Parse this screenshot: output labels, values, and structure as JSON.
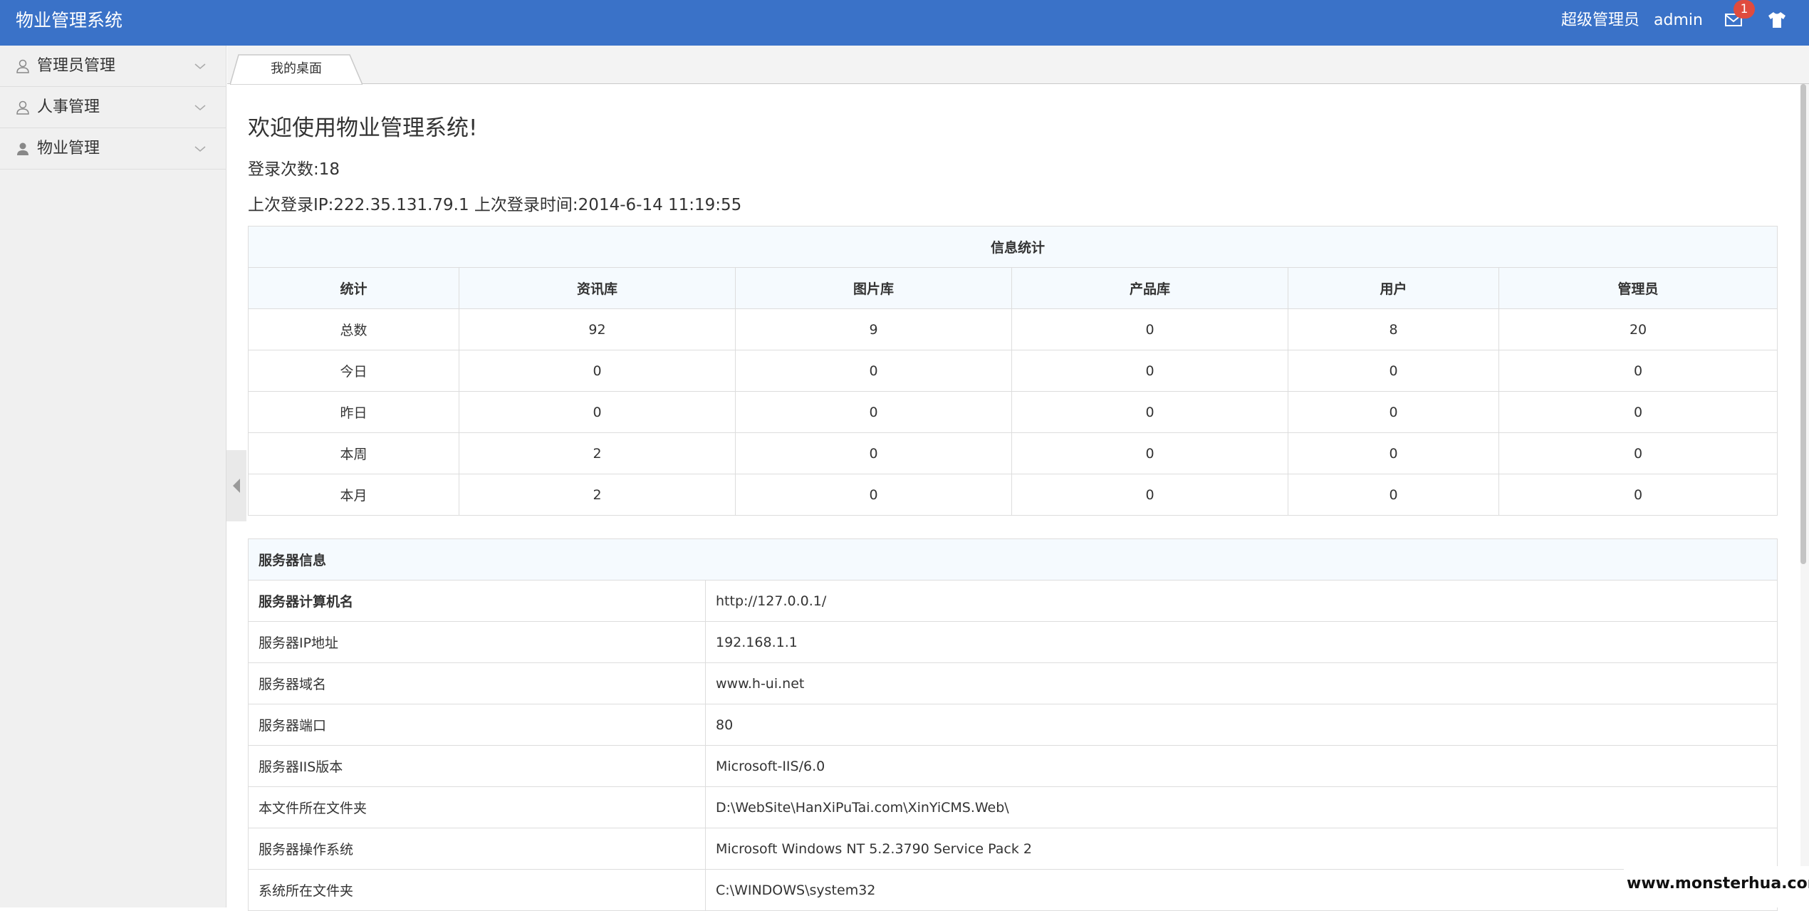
{
  "header": {
    "app_title": "物业管理系统",
    "user_role": "超级管理员",
    "user_name": "admin",
    "message_count": "1",
    "icons": [
      "mail-icon",
      "shirt-icon"
    ]
  },
  "sidebar": {
    "items": [
      {
        "label": "管理员管理",
        "icon": "user-outline-icon"
      },
      {
        "label": "人事管理",
        "icon": "user-outline-icon"
      },
      {
        "label": "物业管理",
        "icon": "user-filled-icon"
      }
    ]
  },
  "tabs": [
    {
      "label": "我的桌面"
    }
  ],
  "main": {
    "welcome": "欢迎使用物业管理系统!",
    "login_count": "登录次数:18",
    "last_login": "上次登录IP:222.35.131.79.1 上次登录时间:2014-6-14 11:19:55"
  },
  "stats_table": {
    "caption": "信息统计",
    "headers": [
      "统计",
      "资讯库",
      "图片库",
      "产品库",
      "用户",
      "管理员"
    ],
    "rows": [
      [
        "总数",
        "92",
        "9",
        "0",
        "8",
        "20"
      ],
      [
        "今日",
        "0",
        "0",
        "0",
        "0",
        "0"
      ],
      [
        "昨日",
        "0",
        "0",
        "0",
        "0",
        "0"
      ],
      [
        "本周",
        "2",
        "0",
        "0",
        "0",
        "0"
      ],
      [
        "本月",
        "2",
        "0",
        "0",
        "0",
        "0"
      ]
    ]
  },
  "server_table": {
    "caption": "服务器信息",
    "rows": [
      [
        "服务器计算机名",
        "http://127.0.0.1/"
      ],
      [
        "服务器IP地址",
        "192.168.1.1"
      ],
      [
        "服务器域名",
        "www.h-ui.net"
      ],
      [
        "服务器端口",
        "80"
      ],
      [
        "服务器IIS版本",
        "Microsoft-IIS/6.0"
      ],
      [
        "本文件所在文件夹",
        "D:\\WebSite\\HanXiPuTai.com\\XinYiCMS.Web\\"
      ],
      [
        "服务器操作系统",
        "Microsoft Windows NT 5.2.3790 Service Pack 2"
      ],
      [
        "系统所在文件夹",
        "C:\\WINDOWS\\system32"
      ]
    ]
  },
  "watermark": "www.monsterhua.com",
  "colors": {
    "header_bg": "#3a72c8",
    "badge_bg": "#e04b3e",
    "sidebar_bg": "#f0f0f0",
    "table_header_bg": "#f5fafe"
  }
}
